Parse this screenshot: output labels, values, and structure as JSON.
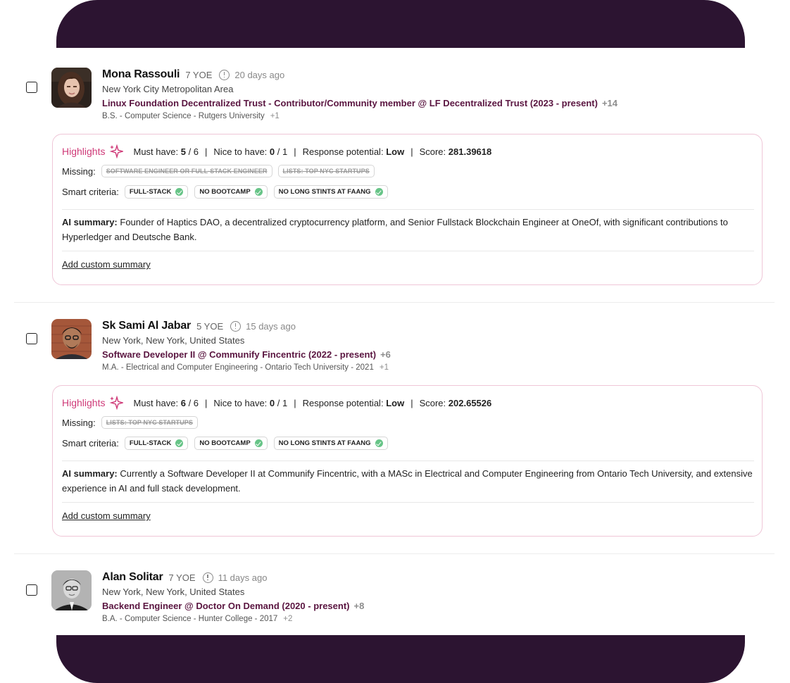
{
  "candidates": [
    {
      "name": "Mona Rassouli",
      "yoe": "7 YOE",
      "ago": "20 days ago",
      "location": "New York City Metropolitan Area",
      "role": "Linux Foundation Decentralized Trust - Contributor/Community member @ LF Decentralized Trust (2023 - present)",
      "role_more": "+14",
      "education": "B.S. - Computer Science - Rutgers University",
      "edu_more": "+1",
      "highlights": {
        "title": "Highlights",
        "must_label": "Must have:",
        "must_value": "5",
        "must_total": "/ 6",
        "nice_label": "Nice to have:",
        "nice_value": "0",
        "nice_total": "/ 1",
        "response_label": "Response potential:",
        "response_value": "Low",
        "score_label": "Score:",
        "score_value": "281.39618",
        "missing_label": "Missing:",
        "missing": [
          "SOFTWARE ENGINEER OR FULL-STACK ENGINEER",
          "LISTS: TOP NYC STARTUPS"
        ],
        "smart_label": "Smart criteria:",
        "smart": [
          "FULL-STACK",
          "NO BOOTCAMP",
          "NO LONG STINTS AT FAANG"
        ],
        "summary_label": "AI summary:",
        "summary_text": "Founder of Haptics DAO, a decentralized cryptocurrency platform, and Senior Fullstack Blockchain Engineer at OneOf, with significant contributions to Hyperledger and Deutsche Bank.",
        "add_summary": "Add custom summary"
      }
    },
    {
      "name": "Sk Sami Al Jabar",
      "yoe": "5 YOE",
      "ago": "15 days ago",
      "location": "New York, New York, United States",
      "role": "Software Developer II @ Communify Fincentric (2022 - present)",
      "role_more": "+6",
      "education": "M.A. - Electrical and Computer Engineering - Ontario Tech University - 2021",
      "edu_more": "+1",
      "highlights": {
        "title": "Highlights",
        "must_label": "Must have:",
        "must_value": "6",
        "must_total": "/ 6",
        "nice_label": "Nice to have:",
        "nice_value": "0",
        "nice_total": "/ 1",
        "response_label": "Response potential:",
        "response_value": "Low",
        "score_label": "Score:",
        "score_value": "202.65526",
        "missing_label": "Missing:",
        "missing": [
          "LISTS: TOP NYC STARTUPS"
        ],
        "smart_label": "Smart criteria:",
        "smart": [
          "FULL-STACK",
          "NO BOOTCAMP",
          "NO LONG STINTS AT FAANG"
        ],
        "summary_label": "AI summary:",
        "summary_text": "Currently a Software Developer II at Communify Fincentric, with a MASc in Electrical and Computer Engineering from Ontario Tech University, and extensive experience in AI and full stack development.",
        "add_summary": "Add custom summary"
      }
    },
    {
      "name": "Alan Solitar",
      "yoe": "7 YOE",
      "ago": "11 days ago",
      "location": "New York, New York, United States",
      "role": "Backend Engineer @ Doctor On Demand (2020 - present)",
      "role_more": "+8",
      "education": "B.A. - Computer Science - Hunter College - 2017",
      "edu_more": "+2"
    }
  ],
  "colors": {
    "band": "#2c1431",
    "role": "#5a1540",
    "highlight_title": "#cf3a78",
    "card_border": "#efc6d7",
    "check": "#67c487"
  }
}
